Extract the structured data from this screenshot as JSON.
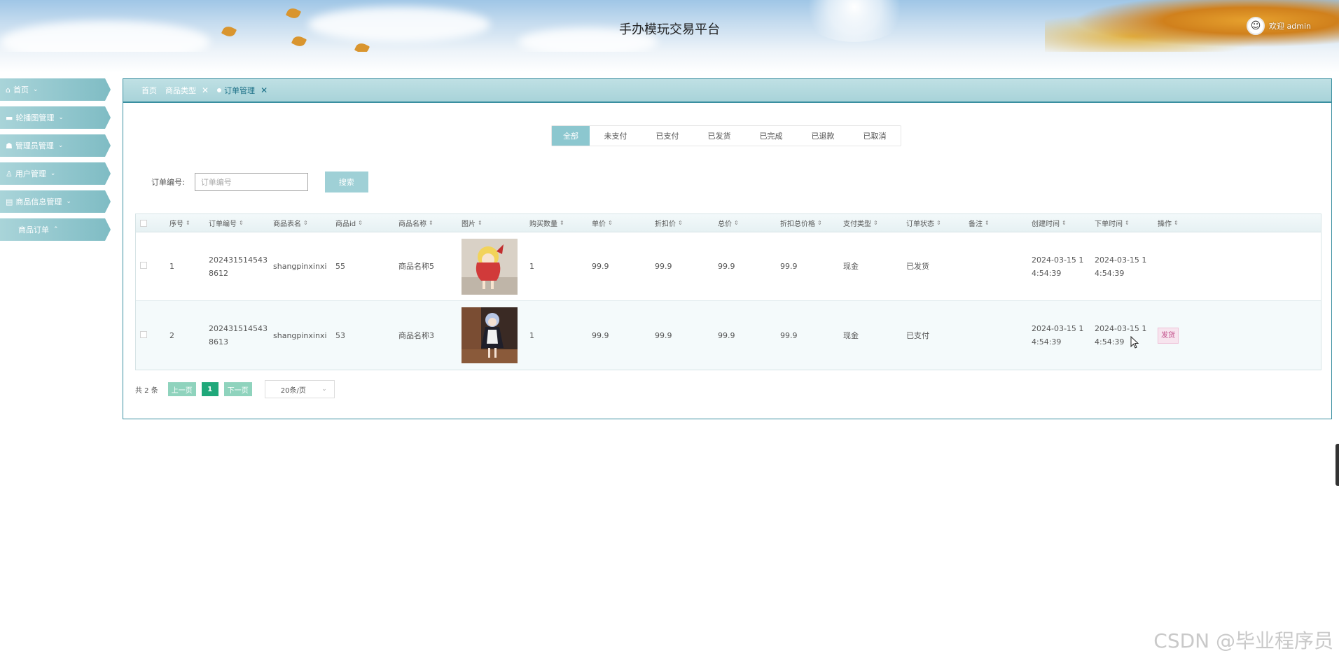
{
  "header": {
    "title": "手办模玩交易平台",
    "welcome": "欢迎 admin",
    "avatar_icon": "user-avatar-icon"
  },
  "sidebar": {
    "items": [
      {
        "label": "首页",
        "icon": "home-icon"
      },
      {
        "label": "轮播图管理",
        "icon": "image-icon"
      },
      {
        "label": "管理员管理",
        "icon": "admin-icon"
      },
      {
        "label": "用户管理",
        "icon": "user-icon"
      },
      {
        "label": "商品信息管理",
        "icon": "goods-icon"
      },
      {
        "label": "商品订单",
        "icon": ""
      }
    ]
  },
  "breadcrumb": {
    "items": [
      {
        "label": "首页"
      },
      {
        "label": "商品类型"
      },
      {
        "label": "订单管理"
      }
    ]
  },
  "status_tabs": [
    "全部",
    "未支付",
    "已支付",
    "已发货",
    "已完成",
    "已退款",
    "已取消"
  ],
  "search": {
    "label": "订单编号:",
    "placeholder": "订单编号",
    "button": "搜索"
  },
  "table": {
    "headers": [
      "序号",
      "订单编号",
      "商品表名",
      "商品id",
      "商品名称",
      "图片",
      "购买数量",
      "单价",
      "折扣价",
      "总价",
      "折扣总价格",
      "支付类型",
      "订单状态",
      "备注",
      "创建时间",
      "下单时间",
      "操作"
    ],
    "rows": [
      {
        "index": "1",
        "order_no": "2024315145438612",
        "table_name": "shangpinxinxi",
        "goods_id": "55",
        "goods_name": "商品名称5",
        "image": "figure-blonde-red-dress",
        "quantity": "1",
        "price": "99.9",
        "discount_price": "99.9",
        "total": "99.9",
        "discount_total": "99.9",
        "pay_type": "现金",
        "status": "已发货",
        "remark": "",
        "created": "2024-03-15 14:54:39",
        "ordered": "2024-03-15 14:54:39",
        "action": ""
      },
      {
        "index": "2",
        "order_no": "2024315145438613",
        "table_name": "shangpinxinxi",
        "goods_id": "53",
        "goods_name": "商品名称3",
        "image": "figure-maid-silver-hair",
        "quantity": "1",
        "price": "99.9",
        "discount_price": "99.9",
        "total": "99.9",
        "discount_total": "99.9",
        "pay_type": "现金",
        "status": "已支付",
        "remark": "",
        "created": "2024-03-15 14:54:39",
        "ordered": "2024-03-15 14:54:39",
        "action": "发货"
      }
    ]
  },
  "pagination": {
    "total": "共 2 条",
    "prev": "上一页",
    "current": "1",
    "next": "下一页",
    "page_size": "20条/页"
  },
  "watermark": "CSDN @毕业程序员",
  "colors": {
    "accent": "#8cc7cf",
    "panel_border": "#3a8fa0",
    "pager_active": "#1fa87a",
    "ship_button": "#c04a86"
  }
}
